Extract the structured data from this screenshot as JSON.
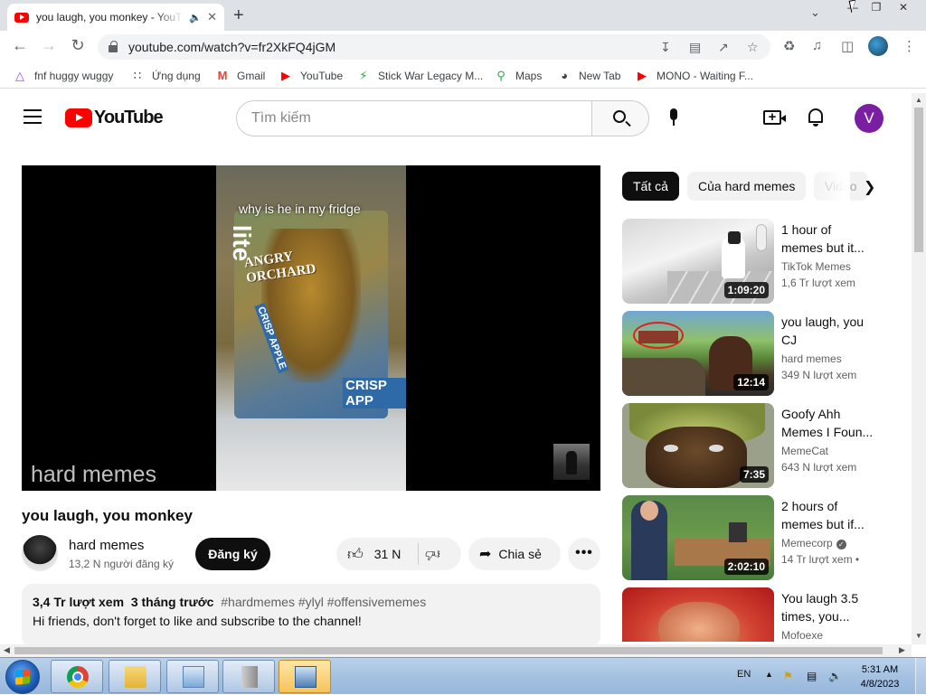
{
  "browser": {
    "tab_title": "you laugh, you monkey - YouTube",
    "tab_audio_icon": "speaker-icon",
    "new_tab_label": "+",
    "url": "youtube.com/watch?v=fr2XkFQ4jGM",
    "bookmarks": [
      {
        "label": "fnf huggy wuggy",
        "icon": "triangle-icon"
      },
      {
        "label": "Ứng dụng",
        "icon": "apps-grid-icon"
      },
      {
        "label": "Gmail",
        "icon": "gmail-icon"
      },
      {
        "label": "YouTube",
        "icon": "youtube-icon"
      },
      {
        "label": "Stick War Legacy M...",
        "icon": "lightning-icon"
      },
      {
        "label": "Maps",
        "icon": "maps-pin-icon"
      },
      {
        "label": "New Tab",
        "icon": "globe-icon"
      },
      {
        "label": "MONO - Waiting F...",
        "icon": "youtube-icon"
      }
    ]
  },
  "youtube": {
    "logo_text": "YouTube",
    "search_placeholder": "Tìm kiếm",
    "avatar_letter": "V",
    "video": {
      "caption": "why is he in my fridge",
      "watermark": "hard memes",
      "title": "you laugh, you monkey",
      "channel": "hard memes",
      "subscribers": "13,2 N người đăng ký",
      "subscribe_label": "Đăng ký",
      "likes": "31 N",
      "share_label": "Chia sẻ",
      "more_label": "•••",
      "views": "3,4 Tr lượt xem",
      "uploaded": "3 tháng trước",
      "hashtags": "#hardmemes #ylyl #offensivememes",
      "description": "Hi friends, don't forget to like and subscribe to the channel!"
    },
    "chips": [
      "Tất cả",
      "Của hard memes",
      "Video"
    ],
    "recommendations": [
      {
        "title": "1 hour of memes but it...",
        "channel": "TikTok Memes",
        "views": "1,6 Tr lượt xem",
        "duration": "1:09:20",
        "verified": false
      },
      {
        "title": "you laugh, you CJ",
        "channel": "hard memes",
        "views": "349 N lượt xem",
        "duration": "12:14",
        "verified": false
      },
      {
        "title": "Goofy Ahh Memes I Foun...",
        "channel": "MemeCat",
        "views": "643 N lượt xem",
        "duration": "7:35",
        "verified": false
      },
      {
        "title": "2 hours of memes but if...",
        "channel": "Memecorp",
        "views": "14 Tr lượt xem •",
        "duration": "2:02:10",
        "verified": true
      },
      {
        "title": "You laugh 3.5 times, you...",
        "channel": "Mofoexe",
        "views": "",
        "duration": "",
        "verified": false
      }
    ]
  },
  "taskbar": {
    "language": "EN",
    "time": "5:31 AM",
    "date": "4/8/2023"
  },
  "colors": {
    "youtube_red": "#ff0000",
    "subscribe_bg": "#0f0f0f",
    "avatar_bg": "#7b1fa2",
    "chip_bg": "#f2f2f2"
  }
}
